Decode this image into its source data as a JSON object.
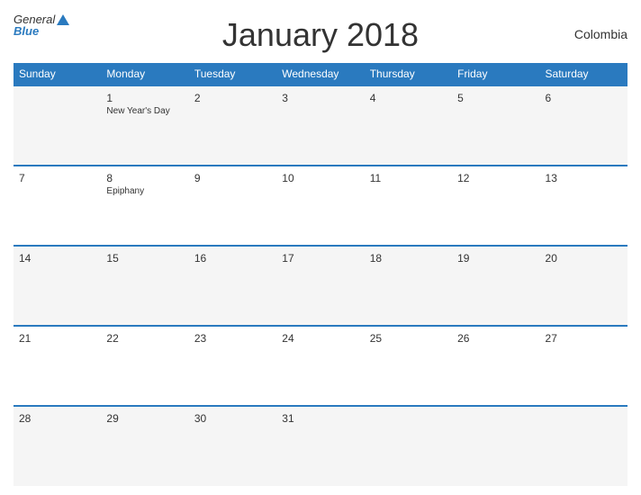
{
  "header": {
    "title": "January 2018",
    "country": "Colombia",
    "logo_general": "General",
    "logo_blue": "Blue"
  },
  "weekdays": [
    "Sunday",
    "Monday",
    "Tuesday",
    "Wednesday",
    "Thursday",
    "Friday",
    "Saturday"
  ],
  "weeks": [
    [
      {
        "day": "",
        "holiday": ""
      },
      {
        "day": "1",
        "holiday": "New Year's Day"
      },
      {
        "day": "2",
        "holiday": ""
      },
      {
        "day": "3",
        "holiday": ""
      },
      {
        "day": "4",
        "holiday": ""
      },
      {
        "day": "5",
        "holiday": ""
      },
      {
        "day": "6",
        "holiday": ""
      }
    ],
    [
      {
        "day": "7",
        "holiday": ""
      },
      {
        "day": "8",
        "holiday": "Epiphany"
      },
      {
        "day": "9",
        "holiday": ""
      },
      {
        "day": "10",
        "holiday": ""
      },
      {
        "day": "11",
        "holiday": ""
      },
      {
        "day": "12",
        "holiday": ""
      },
      {
        "day": "13",
        "holiday": ""
      }
    ],
    [
      {
        "day": "14",
        "holiday": ""
      },
      {
        "day": "15",
        "holiday": ""
      },
      {
        "day": "16",
        "holiday": ""
      },
      {
        "day": "17",
        "holiday": ""
      },
      {
        "day": "18",
        "holiday": ""
      },
      {
        "day": "19",
        "holiday": ""
      },
      {
        "day": "20",
        "holiday": ""
      }
    ],
    [
      {
        "day": "21",
        "holiday": ""
      },
      {
        "day": "22",
        "holiday": ""
      },
      {
        "day": "23",
        "holiday": ""
      },
      {
        "day": "24",
        "holiday": ""
      },
      {
        "day": "25",
        "holiday": ""
      },
      {
        "day": "26",
        "holiday": ""
      },
      {
        "day": "27",
        "holiday": ""
      }
    ],
    [
      {
        "day": "28",
        "holiday": ""
      },
      {
        "day": "29",
        "holiday": ""
      },
      {
        "day": "30",
        "holiday": ""
      },
      {
        "day": "31",
        "holiday": ""
      },
      {
        "day": "",
        "holiday": ""
      },
      {
        "day": "",
        "holiday": ""
      },
      {
        "day": "",
        "holiday": ""
      }
    ]
  ],
  "colors": {
    "header_bg": "#2a7abf",
    "accent": "#2a7abf"
  }
}
